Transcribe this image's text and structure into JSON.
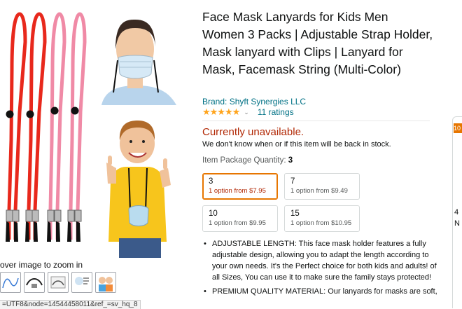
{
  "product": {
    "title": "Face Mask Lanyards for Kids Men Women 3 Packs | Adjustable Strap Holder, Mask lanyard with Clips | Lanyard for Mask, Facemask String (Multi-Color)",
    "brand": "Brand: Shyft Synergies LLC",
    "stars_glyphs": "★★★★★",
    "rating_fraction": 0.9,
    "ratings_count": "11 ratings"
  },
  "availability": {
    "status": "Currently unavailable.",
    "message": "We don't know when or if this item will be back in stock."
  },
  "quantity": {
    "label": "Item Package Quantity:",
    "selected": "3",
    "options": [
      {
        "qty": "3",
        "price": "1 option from $7.95"
      },
      {
        "qty": "7",
        "price": "1 option from $9.49"
      },
      {
        "qty": "10",
        "price": "1 option from $9.95"
      },
      {
        "qty": "15",
        "price": "1 option from $10.95"
      }
    ]
  },
  "bullets": [
    "ADJUSTABLE LENGTH: This face mask holder features a fully adjustable design, allowing you to adapt the length according to your own needs. It's the Perfect choice for both kids and adults! of all Sizes, You can use it to make sure the family stays protected!",
    "PREMIUM QUALITY MATERIAL: Our lanyards for masks are soft,"
  ],
  "gallery": {
    "hint": "over image to zoom in",
    "thumb_icons": [
      "lanyard-thumb",
      "clip-thumb",
      "pack-thumb",
      "infographic-thumb",
      "kids-thumb"
    ]
  },
  "statusbar": {
    "url": "=UTF8&node=14544458011&ref_=sv_hq_8"
  },
  "buybox": {
    "badge_text": "10",
    "edge_chars": [
      "4",
      "N"
    ]
  },
  "colors": {
    "lanyard_red": "#e8281c",
    "lanyard_pink": "#f08aa6",
    "link": "#007185",
    "price_red": "#b12704",
    "accent": "#e77600"
  }
}
